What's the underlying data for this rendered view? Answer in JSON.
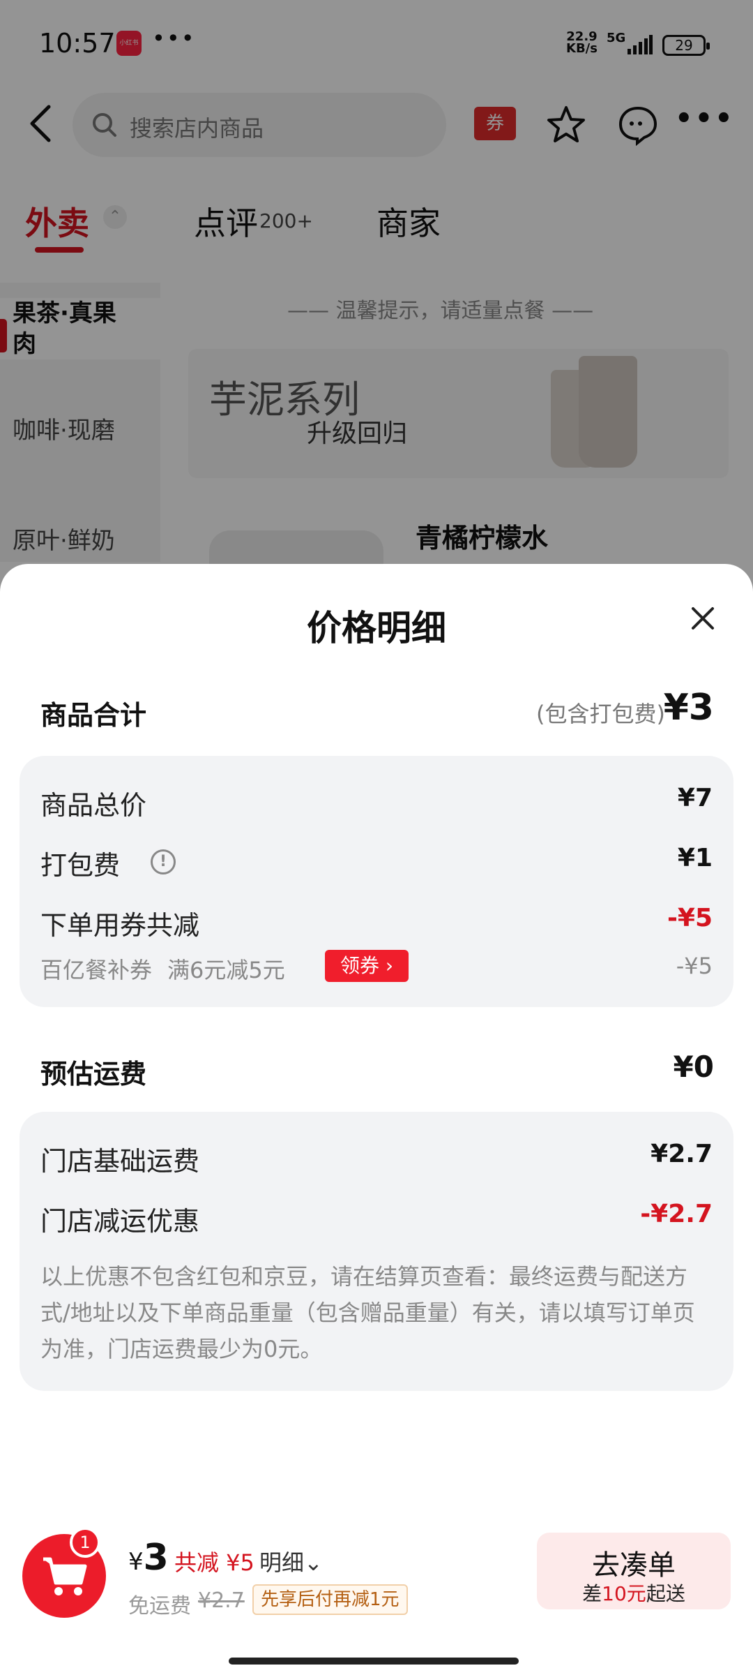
{
  "status_bar": {
    "time": "10:57",
    "app_badge": "小红书",
    "dots": "•••",
    "speed": "22.9\nKB/s",
    "network": "5G",
    "battery": "29"
  },
  "topbar": {
    "search_placeholder": "搜索店内商品",
    "coupon_label": "券",
    "more": "•••"
  },
  "tabs": {
    "waimai": "外卖",
    "dianping": "点评",
    "dianping_count": "200+",
    "shangjia": "商家"
  },
  "sidebar": {
    "items": [
      "果茶·真果肉",
      "咖啡·现磨",
      "原叶·鲜奶"
    ]
  },
  "tip": "—— 温馨提示，请适量点餐 ——",
  "banner": {
    "line1": "芋泥系列",
    "line2": "升级回归"
  },
  "product_name": "青橘柠檬水",
  "sheet": {
    "title": "价格明细",
    "goods_total_label": "商品合计",
    "goods_total_note": "(包含打包费)",
    "goods_total_value": "¥3",
    "rows": [
      {
        "label": "商品总价",
        "value": "¥7"
      },
      {
        "label": "打包费",
        "value": "¥1"
      },
      {
        "label": "下单用券共减",
        "value": "-¥5"
      }
    ],
    "coupon": {
      "name": "百亿餐补券",
      "rule": "满6元减5元",
      "take_label": "领券 ›",
      "value": "-¥5"
    },
    "shipping_label": "预估运费",
    "shipping_value": "¥0",
    "ship_rows": [
      {
        "label": "门店基础运费",
        "value": "¥2.7"
      },
      {
        "label": "门店减运优惠",
        "value": "-¥2.7"
      }
    ],
    "note": "以上优惠不包含红包和京豆，请在结算页查看：最终运费与配送方式/地址以及下单商品重量（包含赠品重量）有关，请以填写订单页为准，门店运费最少为0元。"
  },
  "bottom": {
    "cart_count": "1",
    "total_currency": "¥",
    "total_value": "3",
    "saved": "共减 ¥5",
    "detail": "明细⌄",
    "free_ship": "免运费",
    "strike_price": "¥2.7",
    "promo": "先享后付再减1元",
    "go_title": "去凑单",
    "go_sub_prefix": "差",
    "go_sub_amount": "10元",
    "go_sub_suffix": "起送"
  },
  "colors": {
    "accent_red": "#d4141f",
    "card_bg": "#f2f3f5",
    "overlay": "rgba(0,0,0,0.42)"
  }
}
